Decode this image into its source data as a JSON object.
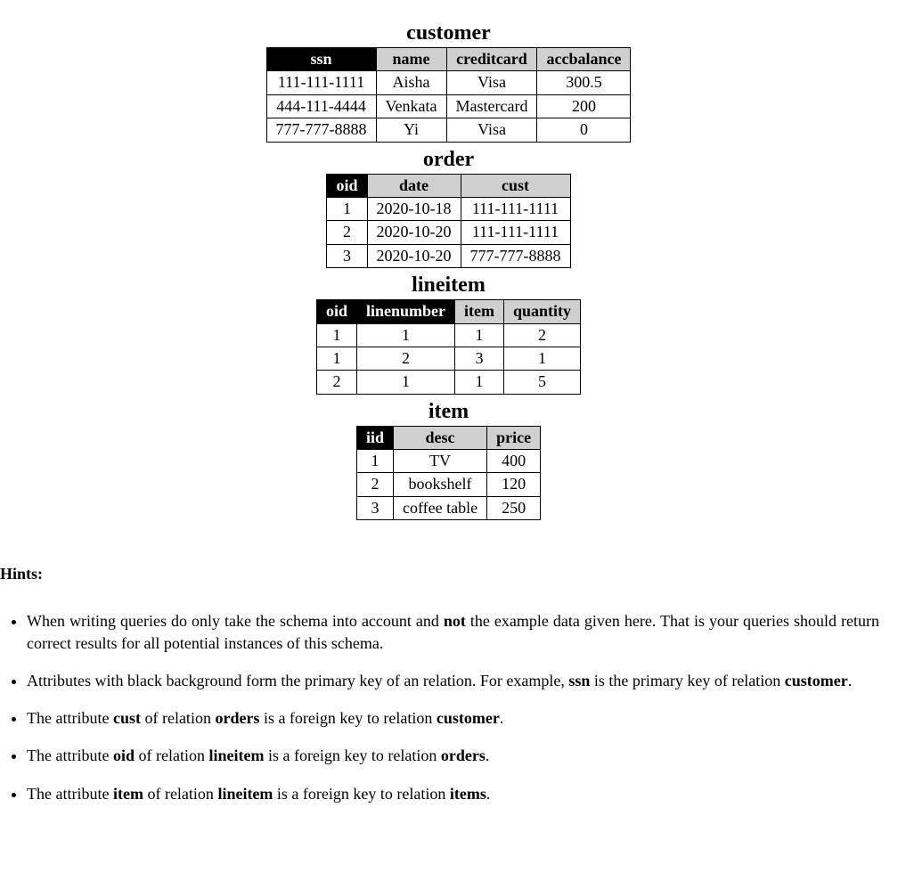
{
  "tables": [
    {
      "title": "customer",
      "columns": [
        {
          "name": "ssn",
          "pk": true
        },
        {
          "name": "name",
          "pk": false
        },
        {
          "name": "creditcard",
          "pk": false
        },
        {
          "name": "accbalance",
          "pk": false
        }
      ],
      "rows": [
        [
          "111-111-1111",
          "Aisha",
          "Visa",
          "300.5"
        ],
        [
          "444-111-4444",
          "Venkata",
          "Mastercard",
          "200"
        ],
        [
          "777-777-8888",
          "Yi",
          "Visa",
          "0"
        ]
      ]
    },
    {
      "title": "order",
      "columns": [
        {
          "name": "oid",
          "pk": true
        },
        {
          "name": "date",
          "pk": false
        },
        {
          "name": "cust",
          "pk": false
        }
      ],
      "rows": [
        [
          "1",
          "2020-10-18",
          "111-111-1111"
        ],
        [
          "2",
          "2020-10-20",
          "111-111-1111"
        ],
        [
          "3",
          "2020-10-20",
          "777-777-8888"
        ]
      ]
    },
    {
      "title": "lineitem",
      "columns": [
        {
          "name": "oid",
          "pk": true
        },
        {
          "name": "linenumber",
          "pk": true
        },
        {
          "name": "item",
          "pk": false
        },
        {
          "name": "quantity",
          "pk": false
        }
      ],
      "rows": [
        [
          "1",
          "1",
          "1",
          "2"
        ],
        [
          "1",
          "2",
          "3",
          "1"
        ],
        [
          "2",
          "1",
          "1",
          "5"
        ]
      ]
    },
    {
      "title": "item",
      "columns": [
        {
          "name": "iid",
          "pk": true
        },
        {
          "name": "desc",
          "pk": false
        },
        {
          "name": "price",
          "pk": false
        }
      ],
      "rows": [
        [
          "1",
          "TV",
          "400"
        ],
        [
          "2",
          "bookshelf",
          "120"
        ],
        [
          "3",
          "coffee table",
          "250"
        ]
      ]
    }
  ],
  "hints_label": "Hints:",
  "hints": [
    {
      "segments": [
        {
          "t": "When writing queries do only take the schema into account and "
        },
        {
          "t": "not",
          "b": true
        },
        {
          "t": " the example data given here. That is your queries should return correct results for all potential instances of this schema."
        }
      ]
    },
    {
      "segments": [
        {
          "t": "Attributes with black background form the primary key of an relation. For example, "
        },
        {
          "t": "ssn",
          "b": true
        },
        {
          "t": " is the primary key of relation "
        },
        {
          "t": "customer",
          "b": true
        },
        {
          "t": "."
        }
      ]
    },
    {
      "segments": [
        {
          "t": "The attribute "
        },
        {
          "t": "cust",
          "b": true
        },
        {
          "t": " of relation "
        },
        {
          "t": "orders",
          "b": true
        },
        {
          "t": " is a foreign key to relation "
        },
        {
          "t": "customer",
          "b": true
        },
        {
          "t": "."
        }
      ]
    },
    {
      "segments": [
        {
          "t": "The attribute "
        },
        {
          "t": "oid",
          "b": true
        },
        {
          "t": " of relation "
        },
        {
          "t": "lineitem",
          "b": true
        },
        {
          "t": " is a foreign key to relation "
        },
        {
          "t": "orders",
          "b": true
        },
        {
          "t": "."
        }
      ]
    },
    {
      "segments": [
        {
          "t": "The attribute "
        },
        {
          "t": "item",
          "b": true
        },
        {
          "t": " of relation "
        },
        {
          "t": "lineitem",
          "b": true
        },
        {
          "t": " is a foreign key to relation "
        },
        {
          "t": "items",
          "b": true
        },
        {
          "t": "."
        }
      ]
    }
  ]
}
